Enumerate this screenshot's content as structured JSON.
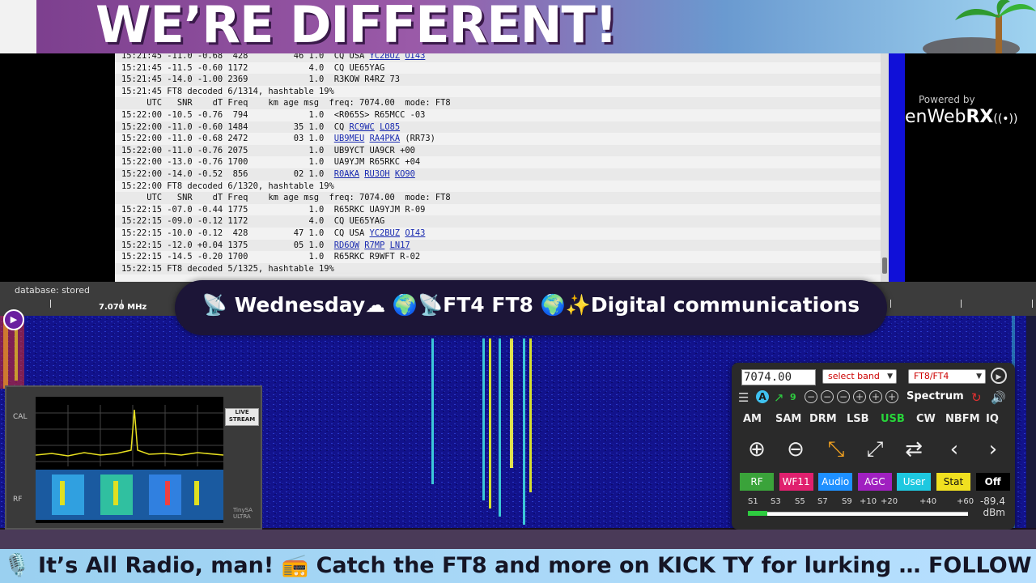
{
  "banner": {
    "text": "WE’RE DIFFERENT!"
  },
  "log": {
    "lines": [
      {
        "text": "15:21:45 -11.0 -0.68  428         46 1.0  CQ USA ",
        "calls": [
          "YC2BUZ",
          "OI43"
        ]
      },
      {
        "text": "15:21:45 -11.5 -0.60 1172            4.0  CQ UE65YAG",
        "calls": []
      },
      {
        "text": "15:21:45 -14.0 -1.00 2369            1.0  R3KOW R4RZ 73",
        "calls": []
      },
      {
        "text": "15:21:45 FT8 decoded 6/1314, hashtable 19%",
        "calls": []
      },
      {
        "text": "     UTC   SNR    dT Freq    km age msg  freq: 7074.00  mode: FT8",
        "calls": []
      },
      {
        "text": "15:22:00 -10.5 -0.76  794            1.0  <R065S> R65MCC -03",
        "calls": []
      },
      {
        "text": "15:22:00 -11.0 -0.60 1484         35 1.0  CQ ",
        "calls": [
          "RC9WC",
          "LO85"
        ]
      },
      {
        "text": "15:22:00 -11.0 -0.68 2472         03 1.0  ",
        "calls": [
          "UB9MEU",
          "RA4PKA"
        ],
        "tail": " (RR73)"
      },
      {
        "text": "15:22:00 -11.0 -0.76 2075            1.0  UB9YCT UA9CR +00",
        "calls": []
      },
      {
        "text": "15:22:00 -13.0 -0.76 1700            1.0  UA9YJM R65RKC +04",
        "calls": []
      },
      {
        "text": "15:22:00 -14.0 -0.52  856         02 1.0  ",
        "calls": [
          "R0AKA",
          "RU3OH",
          "KO90"
        ]
      },
      {
        "text": "15:22:00 FT8 decoded 6/1320, hashtable 19%",
        "calls": []
      },
      {
        "text": "     UTC   SNR    dT Freq    km age msg  freq: 7074.00  mode: FT8",
        "calls": []
      },
      {
        "text": "15:22:15 -07.0 -0.44 1775            1.0  R65RKC UA9YJM R-09",
        "calls": []
      },
      {
        "text": "15:22:15 -09.0 -0.12 1172            4.0  CQ UE65YAG",
        "calls": []
      },
      {
        "text": "15:22:15 -10.0 -0.12  428         47 1.0  CQ USA ",
        "calls": [
          "YC2BUZ",
          "OI43"
        ]
      },
      {
        "text": "15:22:15 -12.0 +0.04 1375         05 1.0  ",
        "calls": [
          "RD6OW",
          "R7MP",
          "LN17"
        ]
      },
      {
        "text": "15:22:15 -14.5 -0.20 1700            1.0  R65RKC R9WFT R-02",
        "calls": []
      },
      {
        "text": "15:22:15 FT8 decoded 5/1325, hashtable 19%",
        "calls": []
      }
    ]
  },
  "openwebrx": {
    "powered_by": "Powered by",
    "brand_prefix": "enWeb",
    "brand_bold": "RX",
    "brand_icon": "((•))"
  },
  "scale": {
    "database": "database: stored",
    "freq_label": "7.070 MHz"
  },
  "title_pill": {
    "text": "📡 Wednesday☁ 🌍📡FT4 FT8 🌍✨Digital communications"
  },
  "control": {
    "frequency": "7074.00",
    "band_select": "select band",
    "mode_select": "FT8/FT4",
    "spectrum_label": "Spectrum",
    "squelch_badge": "A",
    "level_badge": "9",
    "modes": [
      "AM",
      "SAM",
      "DRM",
      "LSB",
      "USB",
      "CW",
      "NBFM",
      "IQ"
    ],
    "active_mode": "USB",
    "buttons": [
      {
        "label": "RF",
        "color": "#3aa33a"
      },
      {
        "label": "WF11",
        "color": "#e0206e"
      },
      {
        "label": "Audio",
        "color": "#1e90ff"
      },
      {
        "label": "AGC",
        "color": "#a020c0"
      },
      {
        "label": "User",
        "color": "#1ec8e0"
      },
      {
        "label": "Stat",
        "color": "#f0e020"
      },
      {
        "label": "Off",
        "color": "#000000"
      }
    ],
    "smeter": {
      "labels": [
        "S1",
        "S3",
        "S5",
        "S7",
        "S9",
        "+10",
        "+20",
        "+40",
        "+60"
      ],
      "reading": "-89.4",
      "unit": "dBm",
      "level_fraction": 0.09
    }
  },
  "inset": {
    "cal": "CAL",
    "rf": "RF",
    "live": "LIVE STREAM",
    "model": "TinySA ULTRA"
  },
  "ticker": {
    "text": "🎙️ It’s All Radio, man! 📻 Catch the FT8 and more on KICK TY for lurking … FOLLOW us on KICK"
  }
}
